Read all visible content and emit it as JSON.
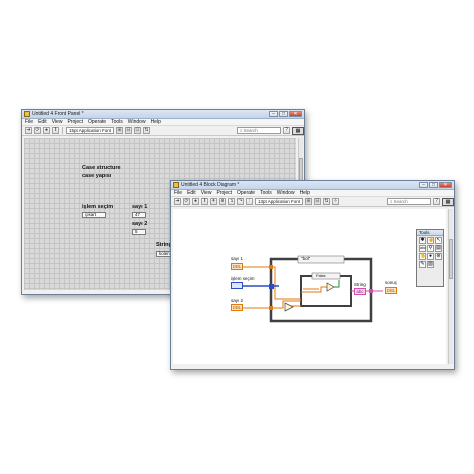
{
  "front_panel": {
    "title": "Untitled 4 Front Panel *",
    "menus": [
      "File",
      "Edit",
      "View",
      "Project",
      "Operate",
      "Tools",
      "Window",
      "Help"
    ],
    "font_select": "15pt Application Font",
    "search_placeholder": "Search",
    "heading_line1": "Case structure",
    "heading_line2": "case yapısı",
    "islem_label": "işlem seçim",
    "islem_value": "çıkart",
    "sayi1_label": "sayı 1",
    "sayi1_value": "47",
    "sayi2_label": "sayı 2",
    "sayi2_value": "5",
    "string_label": "String",
    "string_value": "kolen 0"
  },
  "block_diagram": {
    "title": "Untitled 4 Block Diagram *",
    "menus": [
      "File",
      "Edit",
      "View",
      "Project",
      "Operate",
      "Tools",
      "Window",
      "Help"
    ],
    "font_select": "13pt Application Font",
    "search_placeholder": "Search",
    "sayi1": "sayı 1",
    "islem": "işlem seçim",
    "sayi2": "sayı 2",
    "case_selector": "\"bol\"",
    "inner_case_selector": "False",
    "string_node": "String",
    "sonuc": "sonuç",
    "tools_title": "Tools",
    "help_glyph": "?",
    "abc_glyph": "abc",
    "string_out": "abc",
    "dbl_in": "DBL",
    "dbl_out": "DBL"
  },
  "colors": {
    "titlebar": "#c3d4ea",
    "wire_orange": "#e07a10",
    "wire_pink": "#d04fb0",
    "wire_blue": "#2a4cc8",
    "case_frame": "#404040"
  }
}
